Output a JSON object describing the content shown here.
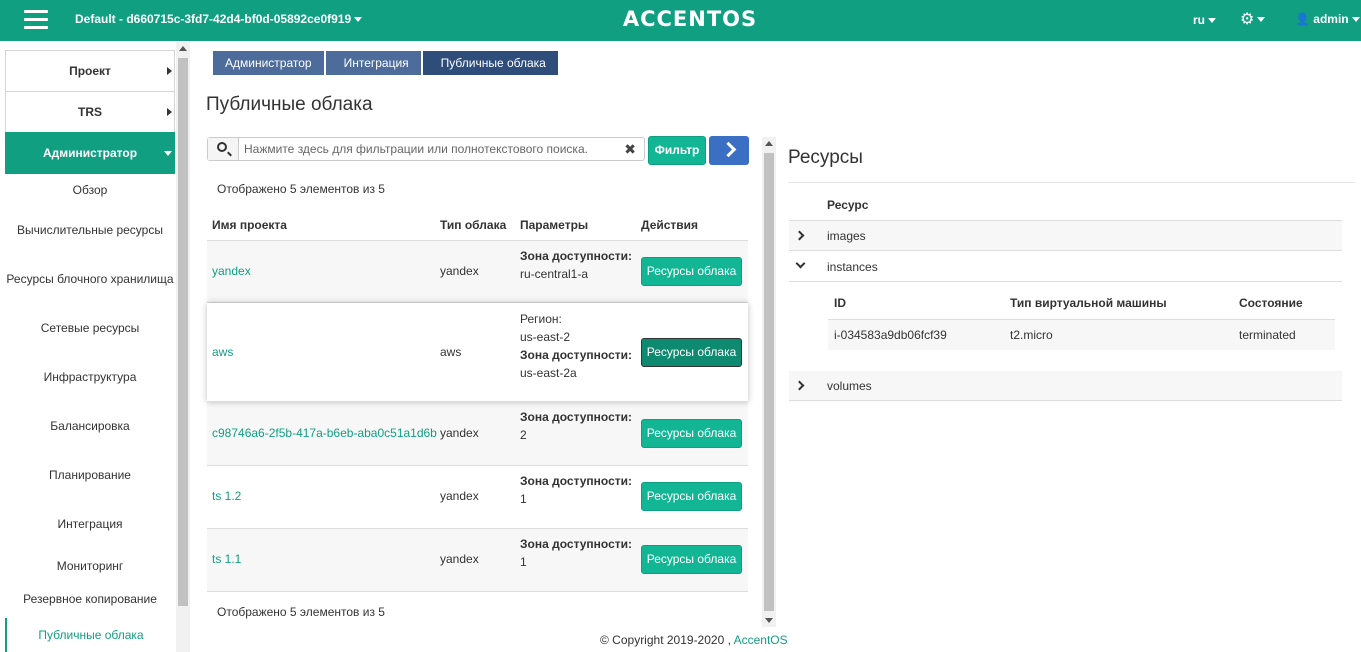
{
  "topbar": {
    "project": "Default - d660715c-3fd7-42d4-bf0d-05892ce0f919",
    "logo": "ACCENTOS",
    "lang": "ru",
    "user": "admin"
  },
  "sidebar": {
    "sections": [
      "Проект",
      "TRS",
      "Администратор"
    ],
    "items": [
      "Обзор",
      "Вычислительные ресурсы",
      "Ресурсы блочного хранилища",
      "Сетевые ресурсы",
      "Инфраструктура",
      "Балансировка",
      "Планирование",
      "Интеграция",
      "Мониторинг",
      "Резервное копирование",
      "Публичные облака"
    ]
  },
  "breadcrumb": [
    "Администратор",
    "Интеграция",
    "Публичные облака"
  ],
  "page_title": "Публичные облака",
  "search": {
    "placeholder": "Нажмите здесь для фильтрации или полнотекстового поиска.",
    "filter_label": "Фильтр"
  },
  "count_text": "Отображено 5 элементов из 5",
  "table": {
    "headers": [
      "Имя проекта",
      "Тип облака",
      "Параметры",
      "Действия"
    ],
    "rows": [
      {
        "name": "yandex",
        "type": "yandex",
        "params": [
          {
            "label": "Зона доступности:",
            "value": "ru-central1-a"
          }
        ],
        "action": "Ресурсы облака"
      },
      {
        "name": "aws",
        "type": "aws",
        "params": [
          {
            "label": "Регион:",
            "value": "us-east-2"
          },
          {
            "label": "Зона доступности:",
            "value": "us-east-2a"
          }
        ],
        "action": "Ресурсы облака"
      },
      {
        "name": "c98746a6-2f5b-417a-b6eb-aba0c51a1d6b",
        "type": "yandex",
        "params": [
          {
            "label": "Зона доступности:",
            "value": "2"
          }
        ],
        "action": "Ресурсы облака"
      },
      {
        "name": "ts 1.2",
        "type": "yandex",
        "params": [
          {
            "label": "Зона доступности:",
            "value": "1"
          }
        ],
        "action": "Ресурсы облака"
      },
      {
        "name": "ts 1.1",
        "type": "yandex",
        "params": [
          {
            "label": "Зона доступности:",
            "value": "1"
          }
        ],
        "action": "Ресурсы облака"
      }
    ]
  },
  "resources": {
    "title": "Ресурсы",
    "header": "Ресурс",
    "items": [
      "images",
      "instances",
      "volumes"
    ],
    "instances": {
      "headers": [
        "ID",
        "Тип виртуальной машины",
        "Состояние"
      ],
      "row": [
        "i-034583a9db06fcf39",
        "t2.micro",
        "terminated"
      ]
    }
  },
  "footer": {
    "text": "© Copyright 2019-2020 ,",
    "link": "AccentOS"
  },
  "colors": {
    "brand": "#119f82",
    "button": "#13b694",
    "breadcrumb": "#4d6c9b"
  }
}
